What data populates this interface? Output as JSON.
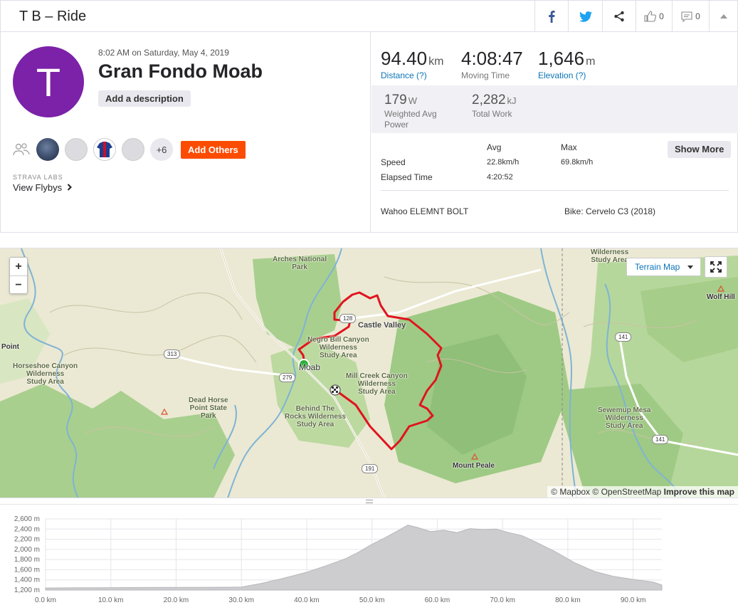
{
  "header": {
    "title": "T B – Ride",
    "kudos_count": "0",
    "comment_count": "0"
  },
  "activity": {
    "avatar_letter": "T",
    "avatar_color": "#7b22a8",
    "datetime": "8:02 AM on Saturday, May 4, 2019",
    "name": "Gran Fondo Moab",
    "add_description": "Add a description",
    "more_athletes": "+6",
    "add_others": "Add Others",
    "labs_label": "STRAVA LABS",
    "flybys_label": "View Flybys"
  },
  "stats": {
    "distance": {
      "value": "94.40",
      "unit": "km",
      "label": "Distance (?)"
    },
    "moving_time": {
      "value": "4:08:47",
      "label": "Moving Time"
    },
    "elevation": {
      "value": "1,646",
      "unit": "m",
      "label": "Elevation (?)"
    },
    "power": {
      "value": "179",
      "unit": "W",
      "label_line1": "Weighted Avg",
      "label_line2": "Power"
    },
    "work": {
      "value": "2,282",
      "unit": "kJ",
      "label": "Total Work"
    },
    "table": {
      "avg_header": "Avg",
      "max_header": "Max",
      "speed_label": "Speed",
      "speed_avg": "22.8km/h",
      "speed_max": "69.8km/h",
      "elapsed_label": "Elapsed Time",
      "elapsed_avg": "4:20:52"
    },
    "show_more": "Show More",
    "device": "Wahoo ELEMNT BOLT",
    "bike": "Bike: Cervelo C3 (2018)"
  },
  "map": {
    "zoom_in": "+",
    "zoom_out": "−",
    "map_type": "Terrain Map",
    "attribution_mapbox": "© Mapbox",
    "attribution_osm": "© OpenStreetMap",
    "attribution_improve": "Improve this map",
    "route_color": "#e0141e",
    "labels": {
      "arches": "Arches National\nPark",
      "castle_valley": "Castle Valley",
      "negro_bill": "Negro Bill Canyon\nWilderness\nStudy Area",
      "moab": "Moab",
      "mill_creek": "Mill Creek Canyon\nWilderness\nStudy Area",
      "behind_rocks": "Behind The\nRocks Wilderness\nStudy Area",
      "dead_horse": "Dead Horse\nPoint State\nPark",
      "horseshoe": "Horseshoe Canyon\nWilderness\nStudy Area",
      "point": "Point",
      "mount_peale": "Mount Peale",
      "wilderness_top": "Wilderness\nStudy Area",
      "wolf_hill": "Wolf Hill",
      "sewemup": "Sewemup Mesa\nWilderness\nStudy Area"
    },
    "shields": {
      "r313": "313",
      "r279": "279",
      "r191": "191",
      "r141a": "141",
      "r141b": "141",
      "r128": "128"
    }
  },
  "chart_data": {
    "type": "area",
    "title": "",
    "xlabel": "",
    "ylabel": "",
    "x_unit": "km",
    "y_unit": "m",
    "xlim": [
      0,
      94.4
    ],
    "ylim": [
      1200,
      2600
    ],
    "x_ticks": [
      "0.0 km",
      "10.0 km",
      "20.0 km",
      "30.0 km",
      "40.0 km",
      "50.0 km",
      "60.0 km",
      "70.0 km",
      "80.0 km",
      "90.0 km"
    ],
    "y_ticks": [
      "1,200 m",
      "1,400 m",
      "1,600 m",
      "1,800 m",
      "2,000 m",
      "2,200 m",
      "2,400 m",
      "2,600 m"
    ],
    "grid": true,
    "series": [
      {
        "x": [
          0,
          5,
          10,
          15,
          20,
          25,
          28,
          30,
          33,
          36,
          40,
          43,
          46,
          48,
          50,
          52,
          54,
          55.5,
          57,
          59,
          61,
          63,
          65,
          67,
          69,
          71,
          73,
          75,
          78,
          81,
          84,
          87,
          90,
          93,
          94.4
        ],
        "y": [
          1240,
          1245,
          1248,
          1250,
          1252,
          1254,
          1256,
          1260,
          1330,
          1420,
          1550,
          1680,
          1820,
          1950,
          2100,
          2230,
          2370,
          2480,
          2430,
          2350,
          2380,
          2330,
          2410,
          2390,
          2400,
          2330,
          2270,
          2150,
          1960,
          1740,
          1570,
          1470,
          1410,
          1360,
          1300
        ]
      }
    ]
  }
}
